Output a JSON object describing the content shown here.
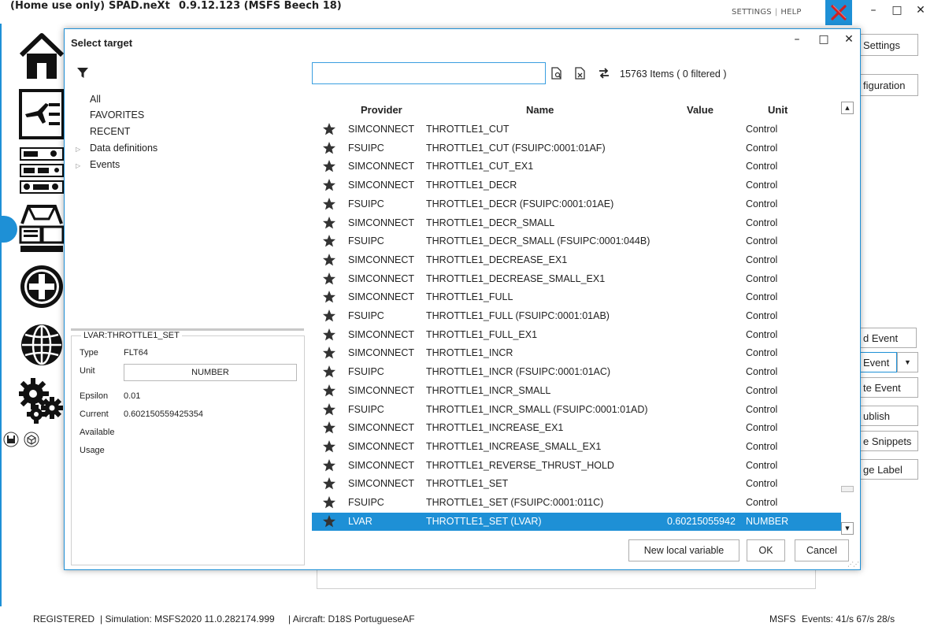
{
  "app": {
    "title_mode": "(Home use only)",
    "title_name": "SPAD.neXt",
    "title_version": "0.9.12.123 (MSFS Beech 18)",
    "settings_link": "SETTINGS",
    "link_sep": "|",
    "help_link": "HELP",
    "minimize": "–",
    "maximize": "□",
    "close": "✕"
  },
  "side_buttons": {
    "settings": "Settings",
    "configuration": "figuration",
    "add_event": "d Event",
    "event": "Event",
    "create_event": "te Event",
    "publish": "ublish",
    "snippets": "e Snippets",
    "label": "ge Label"
  },
  "status": {
    "registered": "REGISTERED",
    "simulation": "| Simulation: MSFS2020 11.0.282174.999",
    "aircraft": "| Aircraft: D18S PortugueseAF",
    "sim_name": "MSFS",
    "events": "Events: 41/s 67/s 28/s"
  },
  "dialog": {
    "title": "Select target",
    "minimize": "–",
    "maximize": "□",
    "close": "✕",
    "tree": {
      "all": "All",
      "favorites": "FAVORITES",
      "recent": "RECENT",
      "data_definitions": "Data definitions",
      "events": "Events"
    },
    "details": {
      "heading": "LVAR:THROTTLE1_SET",
      "type_label": "Type",
      "type_value": "FLT64",
      "unit_label": "Unit",
      "unit_value": "NUMBER",
      "epsilon_label": "Epsilon",
      "epsilon_value": "0.01",
      "current_label": "Current",
      "current_value": "0.602150559425354",
      "available_label": "Available",
      "usage_label": "Usage"
    },
    "search": {
      "value": "",
      "placeholder": ""
    },
    "items_count": "15763 Items ( 0 filtered )",
    "columns": {
      "provider": "Provider",
      "name": "Name",
      "value": "Value",
      "unit": "Unit"
    },
    "rows": [
      {
        "provider": "SIMCONNECT",
        "name": "THROTTLE1_CUT",
        "value": "",
        "unit": "Control"
      },
      {
        "provider": "FSUIPC",
        "name": "THROTTLE1_CUT (FSUIPC:0001:01AF)",
        "value": "",
        "unit": "Control"
      },
      {
        "provider": "SIMCONNECT",
        "name": "THROTTLE1_CUT_EX1",
        "value": "",
        "unit": "Control"
      },
      {
        "provider": "SIMCONNECT",
        "name": "THROTTLE1_DECR",
        "value": "",
        "unit": "Control"
      },
      {
        "provider": "FSUIPC",
        "name": "THROTTLE1_DECR (FSUIPC:0001:01AE)",
        "value": "",
        "unit": "Control"
      },
      {
        "provider": "SIMCONNECT",
        "name": "THROTTLE1_DECR_SMALL",
        "value": "",
        "unit": "Control"
      },
      {
        "provider": "FSUIPC",
        "name": "THROTTLE1_DECR_SMALL (FSUIPC:0001:044B)",
        "value": "",
        "unit": "Control"
      },
      {
        "provider": "SIMCONNECT",
        "name": "THROTTLE1_DECREASE_EX1",
        "value": "",
        "unit": "Control"
      },
      {
        "provider": "SIMCONNECT",
        "name": "THROTTLE1_DECREASE_SMALL_EX1",
        "value": "",
        "unit": "Control"
      },
      {
        "provider": "SIMCONNECT",
        "name": "THROTTLE1_FULL",
        "value": "",
        "unit": "Control"
      },
      {
        "provider": "FSUIPC",
        "name": "THROTTLE1_FULL (FSUIPC:0001:01AB)",
        "value": "",
        "unit": "Control"
      },
      {
        "provider": "SIMCONNECT",
        "name": "THROTTLE1_FULL_EX1",
        "value": "",
        "unit": "Control"
      },
      {
        "provider": "SIMCONNECT",
        "name": "THROTTLE1_INCR",
        "value": "",
        "unit": "Control"
      },
      {
        "provider": "FSUIPC",
        "name": "THROTTLE1_INCR (FSUIPC:0001:01AC)",
        "value": "",
        "unit": "Control"
      },
      {
        "provider": "SIMCONNECT",
        "name": "THROTTLE1_INCR_SMALL",
        "value": "",
        "unit": "Control"
      },
      {
        "provider": "FSUIPC",
        "name": "THROTTLE1_INCR_SMALL (FSUIPC:0001:01AD)",
        "value": "",
        "unit": "Control"
      },
      {
        "provider": "SIMCONNECT",
        "name": "THROTTLE1_INCREASE_EX1",
        "value": "",
        "unit": "Control"
      },
      {
        "provider": "SIMCONNECT",
        "name": "THROTTLE1_INCREASE_SMALL_EX1",
        "value": "",
        "unit": "Control"
      },
      {
        "provider": "SIMCONNECT",
        "name": "THROTTLE1_REVERSE_THRUST_HOLD",
        "value": "",
        "unit": "Control"
      },
      {
        "provider": "SIMCONNECT",
        "name": "THROTTLE1_SET",
        "value": "",
        "unit": "Control"
      },
      {
        "provider": "FSUIPC",
        "name": "THROTTLE1_SET (FSUIPC:0001:011C)",
        "value": "",
        "unit": "Control"
      },
      {
        "provider": "LVAR",
        "name": "THROTTLE1_SET (LVAR)",
        "value": "0.60215055942",
        "unit": "NUMBER",
        "selected": true
      }
    ],
    "buttons": {
      "new_local_variable": "New local variable",
      "ok": "OK",
      "cancel": "Cancel"
    }
  },
  "colors": {
    "accent": "#1e90d6",
    "selection": "#1e90d6",
    "close_x": "#d32020"
  },
  "icons": [
    "home-icon",
    "checklist-icon",
    "radio-stack-icon",
    "cockpit-icon",
    "add-icon",
    "globe-icon",
    "gears-icon",
    "save-icon",
    "package-icon",
    "filter-icon",
    "star-icon"
  ]
}
